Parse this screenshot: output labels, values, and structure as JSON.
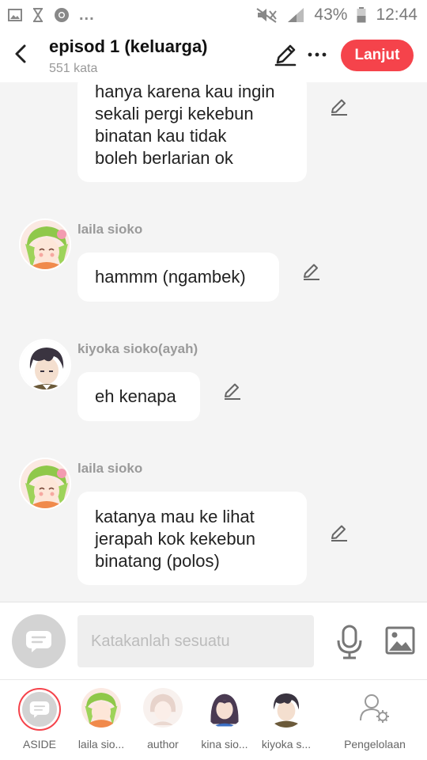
{
  "status_bar": {
    "dots": "...",
    "battery": "43%",
    "time": "12:44"
  },
  "header": {
    "title": "episod 1 (keluarga)",
    "word_count": "551 kata",
    "next_label": "Lanjut"
  },
  "messages": [
    {
      "id": "m0",
      "speaker": "",
      "text": [
        "hanya karena kau ingin",
        "sekali pergi kekebun",
        "binatan kau tidak",
        "boleh berlarian ok"
      ]
    },
    {
      "id": "m1",
      "speaker": "laila sioko",
      "text": [
        "hammm (ngambek)"
      ]
    },
    {
      "id": "m2",
      "speaker": "kiyoka sioko(ayah)",
      "text": [
        "eh kenapa"
      ]
    },
    {
      "id": "m3",
      "speaker": "laila sioko",
      "text": [
        "katanya mau ke lihat",
        "jerapah kok kekebun",
        "binatang (polos)"
      ]
    }
  ],
  "input": {
    "placeholder": "Katakanlah sesuatu"
  },
  "characters": [
    {
      "label": "ASIDE"
    },
    {
      "label": "laila sio..."
    },
    {
      "label": "author"
    },
    {
      "label": "kina sio..."
    },
    {
      "label": "kiyoka s..."
    },
    {
      "label": "Pengelolaan"
    }
  ],
  "colors": {
    "accent": "#f5434b",
    "background": "#f4f4f4",
    "bubble": "#ffffff",
    "muted_text": "#9a9a9a"
  },
  "icons": [
    "image-icon",
    "hourglass-icon",
    "chrome-icon",
    "mute-icon",
    "signal-icon",
    "battery-icon",
    "back-icon",
    "pencil-icon",
    "more-icon",
    "chat-mode-icon",
    "microphone-icon",
    "image-upload-icon",
    "manage-users-icon"
  ]
}
